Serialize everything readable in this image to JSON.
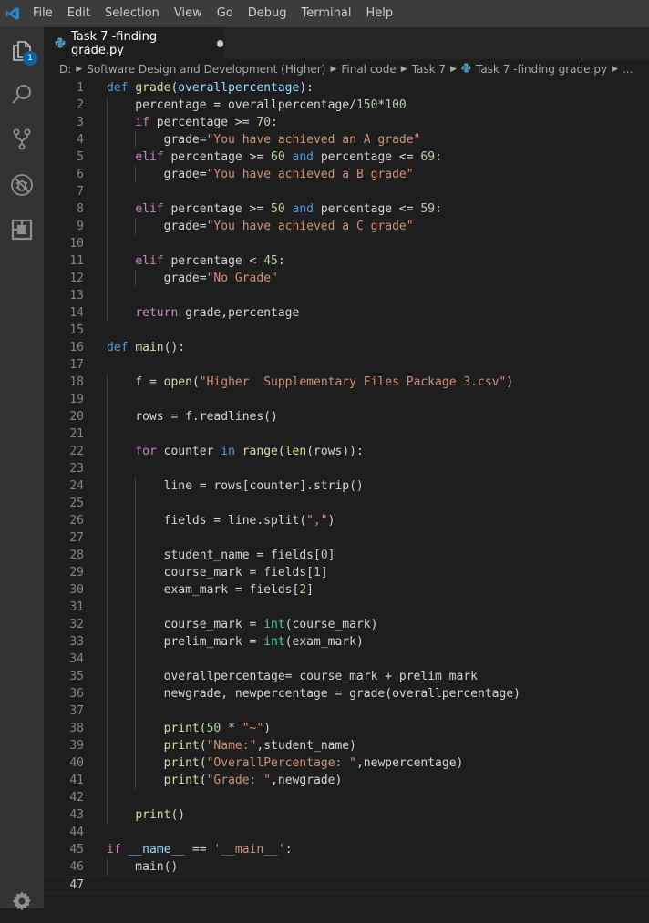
{
  "menu": [
    "File",
    "Edit",
    "Selection",
    "View",
    "Go",
    "Debug",
    "Terminal",
    "Help"
  ],
  "activity": [
    {
      "name": "explorer-icon",
      "badge": "1"
    },
    {
      "name": "search-icon"
    },
    {
      "name": "source-control-icon"
    },
    {
      "name": "debug-icon"
    },
    {
      "name": "extensions-icon"
    },
    {
      "name": "settings-gear-icon"
    }
  ],
  "tab": {
    "label": "Task 7 -finding grade.py",
    "modified": true
  },
  "breadcrumb": [
    "D:",
    "Software Design and Development (Higher)",
    "Final code",
    "Task 7",
    "Task 7 -finding grade.py",
    "..."
  ],
  "editor": {
    "current_line": 47,
    "lines": [
      [
        [
          "k",
          "def "
        ],
        [
          "f",
          "grade"
        ],
        [
          "p",
          "("
        ],
        [
          "v",
          "overallpercentage"
        ],
        [
          "p",
          "):"
        ]
      ],
      [
        [
          "p",
          "    percentage = overallpercentage/"
        ],
        [
          "n",
          "150"
        ],
        [
          "p",
          "*"
        ],
        [
          "n",
          "100"
        ]
      ],
      [
        [
          "p",
          "    "
        ],
        [
          "c",
          "if"
        ],
        [
          "p",
          " percentage >= "
        ],
        [
          "n",
          "70"
        ],
        [
          "p",
          ":"
        ]
      ],
      [
        [
          "p",
          "        grade="
        ],
        [
          "s",
          "\"You have achieved an A grade\""
        ]
      ],
      [
        [
          "p",
          "    "
        ],
        [
          "c",
          "elif"
        ],
        [
          "p",
          " percentage >= "
        ],
        [
          "n",
          "60"
        ],
        [
          "p",
          " "
        ],
        [
          "k",
          "and"
        ],
        [
          "p",
          " percentage <= "
        ],
        [
          "n",
          "69"
        ],
        [
          "p",
          ":"
        ]
      ],
      [
        [
          "p",
          "        grade="
        ],
        [
          "s",
          "\"You have achieved a B grade\""
        ]
      ],
      [],
      [
        [
          "p",
          "    "
        ],
        [
          "c",
          "elif"
        ],
        [
          "p",
          " percentage >= "
        ],
        [
          "n",
          "50"
        ],
        [
          "p",
          " "
        ],
        [
          "k",
          "and"
        ],
        [
          "p",
          " percentage <= "
        ],
        [
          "n",
          "59"
        ],
        [
          "p",
          ":"
        ]
      ],
      [
        [
          "p",
          "        grade="
        ],
        [
          "s",
          "\"You have achieved a C grade\""
        ]
      ],
      [],
      [
        [
          "p",
          "    "
        ],
        [
          "c",
          "elif"
        ],
        [
          "p",
          " percentage < "
        ],
        [
          "n",
          "45"
        ],
        [
          "p",
          ":"
        ]
      ],
      [
        [
          "p",
          "        grade="
        ],
        [
          "s",
          "\"No Grade\""
        ]
      ],
      [],
      [
        [
          "p",
          "    "
        ],
        [
          "c",
          "return"
        ],
        [
          "p",
          " grade,percentage"
        ]
      ],
      [],
      [
        [
          "k",
          "def "
        ],
        [
          "f",
          "main"
        ],
        [
          "p",
          "():"
        ]
      ],
      [],
      [
        [
          "p",
          "    f = "
        ],
        [
          "f",
          "open"
        ],
        [
          "p",
          "("
        ],
        [
          "s",
          "\"Higher  Supplementary Files Package 3.csv\""
        ],
        [
          "p",
          ")"
        ]
      ],
      [],
      [
        [
          "p",
          "    rows = f.readlines()"
        ]
      ],
      [],
      [
        [
          "p",
          "    "
        ],
        [
          "c",
          "for"
        ],
        [
          "p",
          " counter "
        ],
        [
          "k",
          "in"
        ],
        [
          "p",
          " "
        ],
        [
          "f",
          "range"
        ],
        [
          "p",
          "("
        ],
        [
          "f",
          "len"
        ],
        [
          "p",
          "(rows)):"
        ]
      ],
      [],
      [
        [
          "p",
          "        line = rows[counter].strip()"
        ]
      ],
      [],
      [
        [
          "p",
          "        fields = line.split("
        ],
        [
          "s",
          "\",\""
        ],
        [
          "p",
          ")"
        ]
      ],
      [],
      [
        [
          "p",
          "        student_name = fields["
        ],
        [
          "n",
          "0"
        ],
        [
          "p",
          "]"
        ]
      ],
      [
        [
          "p",
          "        course_mark = fields["
        ],
        [
          "n",
          "1"
        ],
        [
          "p",
          "]"
        ]
      ],
      [
        [
          "p",
          "        exam_mark = fields["
        ],
        [
          "n",
          "2"
        ],
        [
          "p",
          "]"
        ]
      ],
      [],
      [
        [
          "p",
          "        course_mark = "
        ],
        [
          "t",
          "int"
        ],
        [
          "p",
          "(course_mark)"
        ]
      ],
      [
        [
          "p",
          "        prelim_mark = "
        ],
        [
          "t",
          "int"
        ],
        [
          "p",
          "(exam_mark)"
        ]
      ],
      [],
      [
        [
          "p",
          "        overallpercentage= course_mark + prelim_mark"
        ]
      ],
      [
        [
          "p",
          "        newgrade, newpercentage = grade(overallpercentage)"
        ]
      ],
      [],
      [
        [
          "p",
          "        "
        ],
        [
          "f",
          "print"
        ],
        [
          "p",
          "("
        ],
        [
          "n",
          "50"
        ],
        [
          "p",
          " * "
        ],
        [
          "s",
          "\"~\""
        ],
        [
          "p",
          ")"
        ]
      ],
      [
        [
          "p",
          "        "
        ],
        [
          "f",
          "print"
        ],
        [
          "p",
          "("
        ],
        [
          "s",
          "\"Name:\""
        ],
        [
          "p",
          ",student_name)"
        ]
      ],
      [
        [
          "p",
          "        "
        ],
        [
          "f",
          "print"
        ],
        [
          "p",
          "("
        ],
        [
          "s",
          "\"OverallPercentage: \""
        ],
        [
          "p",
          ",newpercentage)"
        ]
      ],
      [
        [
          "p",
          "        "
        ],
        [
          "f",
          "print"
        ],
        [
          "p",
          "("
        ],
        [
          "s",
          "\"Grade: \""
        ],
        [
          "p",
          ",newgrade)"
        ]
      ],
      [],
      [
        [
          "p",
          "    "
        ],
        [
          "f",
          "print"
        ],
        [
          "p",
          "()"
        ]
      ],
      [],
      [
        [
          "c",
          "if"
        ],
        [
          "p",
          " "
        ],
        [
          "v",
          "__name__"
        ],
        [
          "p",
          " == "
        ],
        [
          "s",
          "'__main__'"
        ],
        [
          "p",
          ":"
        ]
      ],
      [
        [
          "p",
          "    main()"
        ]
      ],
      []
    ]
  }
}
